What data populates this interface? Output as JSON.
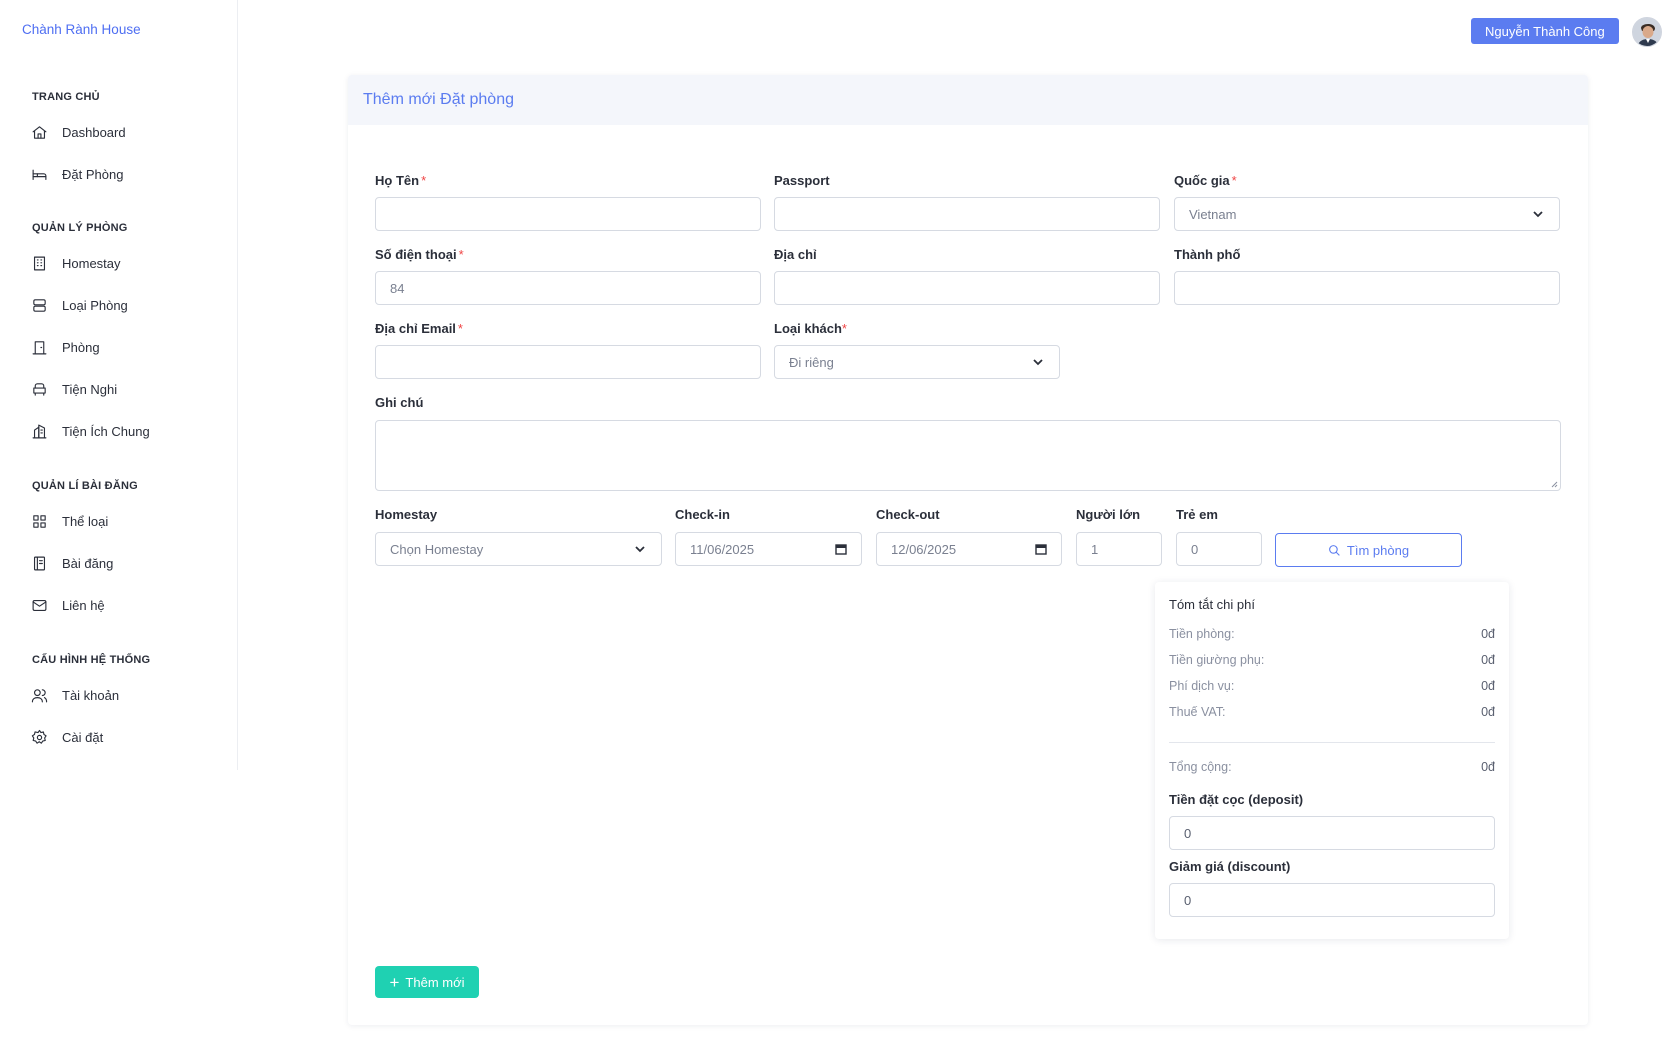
{
  "app": {
    "brand": "Chành Rành House"
  },
  "header": {
    "user_name": "Nguyễn Thành Công"
  },
  "sidebar": {
    "sections": [
      {
        "title": "TRANG CHỦ",
        "items": [
          {
            "label": "Dashboard",
            "icon": "home-icon"
          },
          {
            "label": "Đặt Phòng",
            "icon": "bed-icon"
          }
        ]
      },
      {
        "title": "QUẢN LÝ PHÒNG",
        "items": [
          {
            "label": "Homestay",
            "icon": "building-icon"
          },
          {
            "label": "Loại Phòng",
            "icon": "server-icon"
          },
          {
            "label": "Phòng",
            "icon": "door-icon"
          },
          {
            "label": "Tiện Nghi",
            "icon": "sofa-icon"
          },
          {
            "label": "Tiện Ích Chung",
            "icon": "buildings-icon"
          }
        ]
      },
      {
        "title": "QUẢN LÍ BÀI ĐĂNG",
        "items": [
          {
            "label": "Thể loại",
            "icon": "grid-icon"
          },
          {
            "label": "Bài đăng",
            "icon": "book-icon"
          },
          {
            "label": "Liên hệ",
            "icon": "mail-icon"
          }
        ]
      },
      {
        "title": "CẤU HÌNH HỆ THỐNG",
        "items": [
          {
            "label": "Tài khoản",
            "icon": "users-icon"
          },
          {
            "label": "Cài đặt",
            "icon": "gear-icon"
          }
        ]
      }
    ]
  },
  "form": {
    "title": "Thêm mới Đặt phòng",
    "ho_ten": {
      "label": "Họ Tên",
      "required": "*",
      "value": ""
    },
    "passport": {
      "label": "Passport",
      "value": ""
    },
    "quoc_gia": {
      "label": "Quốc gia",
      "required": "*",
      "value": "Vietnam"
    },
    "so_dien_thoai": {
      "label": "Số điện thoại",
      "required": "*",
      "value": "84"
    },
    "dia_chi": {
      "label": "Địa chỉ",
      "value": ""
    },
    "thanh_pho": {
      "label": "Thành phố",
      "value": ""
    },
    "email": {
      "label": "Địa chỉ Email",
      "required": "*",
      "value": ""
    },
    "loai_khach": {
      "label": "Loại khách",
      "required": "*",
      "value": "Đi riêng"
    },
    "ghi_chu": {
      "label": "Ghi chú",
      "value": ""
    },
    "homestay": {
      "label": "Homestay",
      "value": "Chọn Homestay"
    },
    "check_in": {
      "label": "Check-in",
      "value": "11/06/2025"
    },
    "check_out": {
      "label": "Check-out",
      "value": "12/06/2025"
    },
    "nguoi_lon": {
      "label": "Người lớn",
      "value": "1"
    },
    "tre_em": {
      "label": "Trẻ em",
      "value": "0"
    },
    "search_button": "Tìm phòng",
    "submit_button": "Thêm mới"
  },
  "summary": {
    "title": "Tóm tắt chi phí",
    "rows": [
      {
        "label": "Tiền phòng:",
        "value": "0đ"
      },
      {
        "label": "Tiền giường phụ:",
        "value": "0đ"
      },
      {
        "label": "Phí dịch vụ:",
        "value": "0đ"
      },
      {
        "label": "Thuế VAT:",
        "value": "0đ"
      }
    ],
    "total": {
      "label": "Tổng cộng:",
      "value": "0đ"
    },
    "deposit": {
      "label": "Tiền đặt cọc (deposit)",
      "value": "0"
    },
    "discount": {
      "label": "Giảm giá (discount)",
      "value": "0"
    }
  },
  "colors": {
    "primary": "#5b7cf0",
    "success": "#1fd1b2",
    "required": "#ef4444"
  }
}
